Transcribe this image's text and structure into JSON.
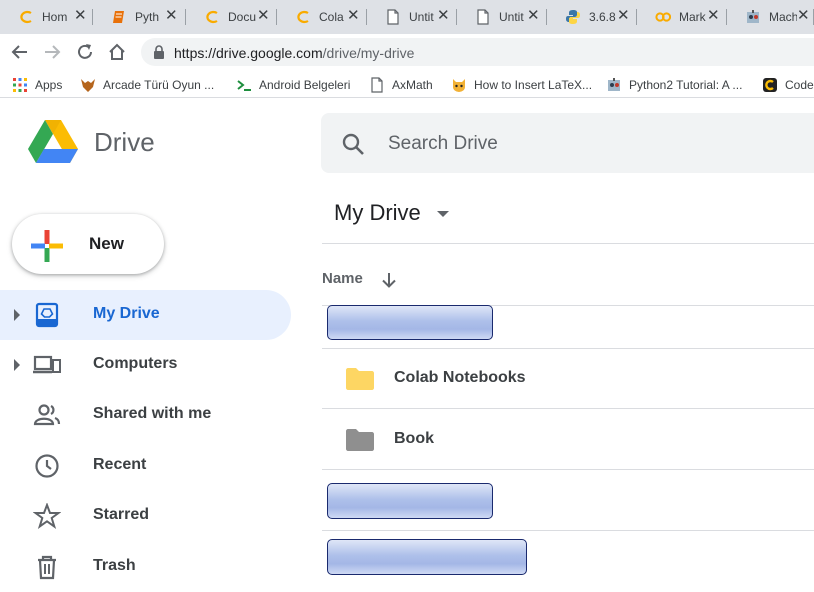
{
  "browser": {
    "tabs": [
      {
        "title": "Hom",
        "icon": "colab-icon"
      },
      {
        "title": "Pyth",
        "icon": "book-icon"
      },
      {
        "title": "Docu",
        "icon": "colab-icon"
      },
      {
        "title": "Cola",
        "icon": "colab-icon"
      },
      {
        "title": "Untit",
        "icon": "page-icon"
      },
      {
        "title": "Untit",
        "icon": "page-icon"
      },
      {
        "title": "3.6.8",
        "icon": "python-icon"
      },
      {
        "title": "Mark",
        "icon": "co-icon"
      },
      {
        "title": "Mach",
        "icon": "robot-icon"
      }
    ],
    "url_host": "https://drive.google.com",
    "url_path": "/drive/my-drive",
    "bookmarks": [
      {
        "label": "Apps",
        "icon": "apps-grid-icon"
      },
      {
        "label": "Arcade Türü Oyun ...",
        "icon": "fox-icon"
      },
      {
        "label": "Android Belgeleri",
        "icon": "terminal-icon"
      },
      {
        "label": "AxMath",
        "icon": "page-icon"
      },
      {
        "label": "How to Insert LaTeX...",
        "icon": "cat-icon"
      },
      {
        "label": "Python2 Tutorial: A ...",
        "icon": "robot-icon"
      },
      {
        "label": "Code",
        "icon": "code-icon"
      }
    ]
  },
  "drive": {
    "app_title": "Drive",
    "search_placeholder": "Search Drive",
    "new_label": "New",
    "nav": [
      {
        "label": "My Drive",
        "icon": "my-drive-icon",
        "active": true,
        "expandable": true
      },
      {
        "label": "Computers",
        "icon": "computers-icon",
        "active": false,
        "expandable": true
      },
      {
        "label": "Shared with me",
        "icon": "shared-people-icon",
        "active": false,
        "expandable": false
      },
      {
        "label": "Recent",
        "icon": "clock-icon",
        "active": false,
        "expandable": false
      },
      {
        "label": "Starred",
        "icon": "star-icon",
        "active": false,
        "expandable": false
      },
      {
        "label": "Trash",
        "icon": "trash-icon",
        "active": false,
        "expandable": false
      }
    ],
    "section_title": "My Drive",
    "column_name": "Name",
    "sort_direction": "descending",
    "rows": [
      {
        "label": "Colab Notebooks",
        "icon": "folder-icon",
        "color": "#fdd663"
      },
      {
        "label": "Book",
        "icon": "folder-icon",
        "color": "#8f8f8f"
      }
    ]
  },
  "colors": {
    "accent": "#1967d2",
    "active_bg": "#e8f0fe"
  }
}
